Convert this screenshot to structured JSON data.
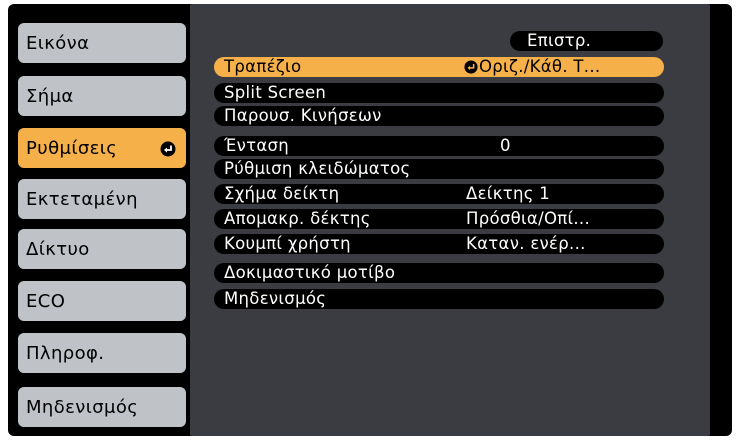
{
  "left_menu": {
    "items": [
      {
        "label": "Εικόνα",
        "active": false
      },
      {
        "label": "Σήμα",
        "active": false
      },
      {
        "label": "Ρυθμίσεις",
        "active": true
      },
      {
        "label": "Εκτεταμένη",
        "active": false
      },
      {
        "label": "Δίκτυο",
        "active": false
      },
      {
        "label": "ECO",
        "active": false
      },
      {
        "label": "Πληροφ.",
        "active": false
      },
      {
        "label": "Μηδενισμός",
        "active": false
      }
    ]
  },
  "main": {
    "return_label": "Επιστρ.",
    "rows": [
      {
        "label": "Τραπέζιο",
        "value": "Οριζ./Κάθ. Τ...",
        "selected": true
      },
      {
        "label": "Split Screen",
        "value": ""
      },
      {
        "label": "Παρουσ. Κινήσεων",
        "value": ""
      },
      {
        "label": "Ένταση",
        "value": "0"
      },
      {
        "label": "Ρύθμιση κλειδώματος",
        "value": ""
      },
      {
        "label": "Σχήμα δείκτη",
        "value": "Δείκτης 1"
      },
      {
        "label": "Απομακρ. δέκτης",
        "value": "Πρόσθια/Οπί..."
      },
      {
        "label": "Κουμπί χρήστη",
        "value": "Καταν. ενέρ..."
      },
      {
        "label": "Δοκιμαστικό μοτίβο",
        "value": ""
      },
      {
        "label": "Μηδενισμός",
        "value": ""
      }
    ]
  },
  "colors": {
    "highlight": "#f5b04a",
    "tab_inactive": "#bfc2c7",
    "panel": "#3a3c42",
    "frame": "#000000"
  },
  "icons": {
    "enter": "enter-icon"
  }
}
